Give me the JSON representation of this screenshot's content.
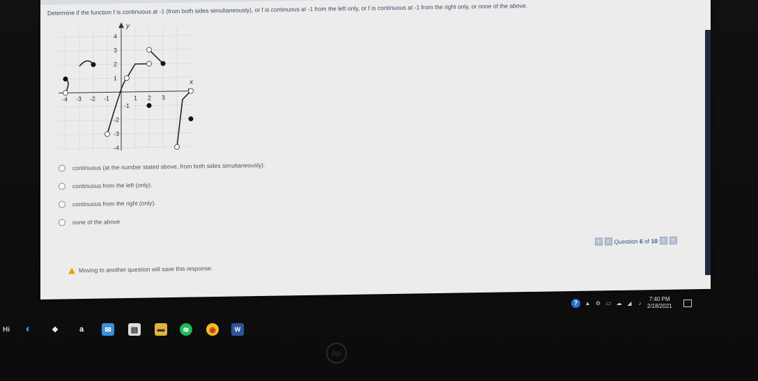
{
  "question": "Determine if the function f is continuous at -1 (from both sides simultaneously), or f is continuous at -1 from the left only, or f is continuous at -1 from the right only, or none of the above.",
  "graph": {
    "y_label": "y",
    "x_label": "x",
    "x_ticks": [
      "-4",
      "-3",
      "-2",
      "-1",
      "1",
      "2",
      "3"
    ],
    "y_ticks": [
      "4",
      "3",
      "2",
      "1",
      "-1",
      "-2",
      "-3",
      "-4"
    ]
  },
  "options": [
    {
      "label": "continuous (at the number stated above, from both sides simultaneously)."
    },
    {
      "label": "continuous from the left (only)."
    },
    {
      "label": "continuous from the right (only)."
    },
    {
      "label": "none of the above"
    }
  ],
  "navigation": {
    "first": "«",
    "prev": "‹",
    "counter_prefix": "Question",
    "current": "6",
    "of_word": "of",
    "total": "10",
    "next": "›",
    "last": "»"
  },
  "warning": "Moving to another question will save this response.",
  "tray": {
    "help": "?",
    "time": "7:40 PM",
    "date": "2/18/2021"
  },
  "taskbar": {
    "left_label": "Hi",
    "amazon": "a",
    "word": "W",
    "brand_logo": "hp"
  },
  "colors": {
    "page_bg": "#ececec",
    "question_text": "#3a4b66",
    "warning_icon": "#e2a400",
    "nav_link": "#2f4f8a"
  }
}
